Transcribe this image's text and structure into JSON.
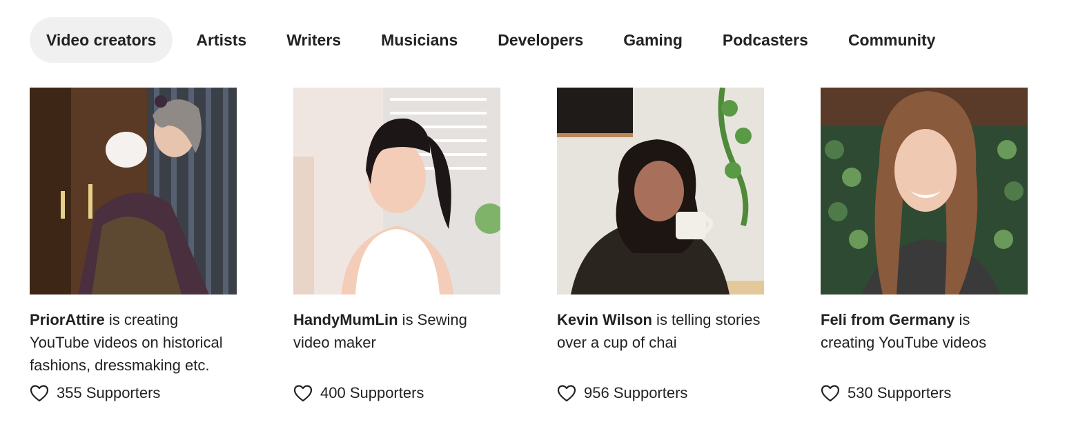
{
  "tabs": [
    {
      "label": "Video creators",
      "active": true
    },
    {
      "label": "Artists",
      "active": false
    },
    {
      "label": "Writers",
      "active": false
    },
    {
      "label": "Musicians",
      "active": false
    },
    {
      "label": "Developers",
      "active": false
    },
    {
      "label": "Gaming",
      "active": false
    },
    {
      "label": "Podcasters",
      "active": false
    },
    {
      "label": "Community",
      "active": false
    }
  ],
  "creators": [
    {
      "name": "PriorAttire",
      "tagline": " is creating YouTube videos on historical fashions, dressmaking etc.",
      "supporters": "355 Supporters",
      "photo_colors": {
        "bg": "#5a3a24",
        "accent": "#4a2f3f",
        "skin": "#e7c4ad",
        "hair": "#8f8a86"
      }
    },
    {
      "name": "HandyMumLin",
      "tagline": " is Sewing video maker",
      "supporters": "400 Supporters",
      "photo_colors": {
        "bg": "#efe6e2",
        "accent": "#ffffff",
        "skin": "#f3cdb8",
        "hair": "#1d1617"
      }
    },
    {
      "name": "Kevin Wilson",
      "tagline": " is telling stories over a cup of chai",
      "supporters": "956 Supporters",
      "photo_colors": {
        "bg": "#e7e4dd",
        "accent": "#2b2520",
        "skin": "#a8705a",
        "hair": "#1c1512"
      }
    },
    {
      "name": "Feli from Germany",
      "tagline": " is creating YouTube videos",
      "supporters": "530 Supporters",
      "photo_colors": {
        "bg": "#2f4a32",
        "accent": "#3a3a3a",
        "skin": "#f0c9b3",
        "hair": "#8a5a3c"
      }
    }
  ],
  "icons": {
    "supporters": "heart-outline-icon"
  },
  "colors": {
    "text": "#222222",
    "active_tab_bg": "#f0f0f0"
  }
}
